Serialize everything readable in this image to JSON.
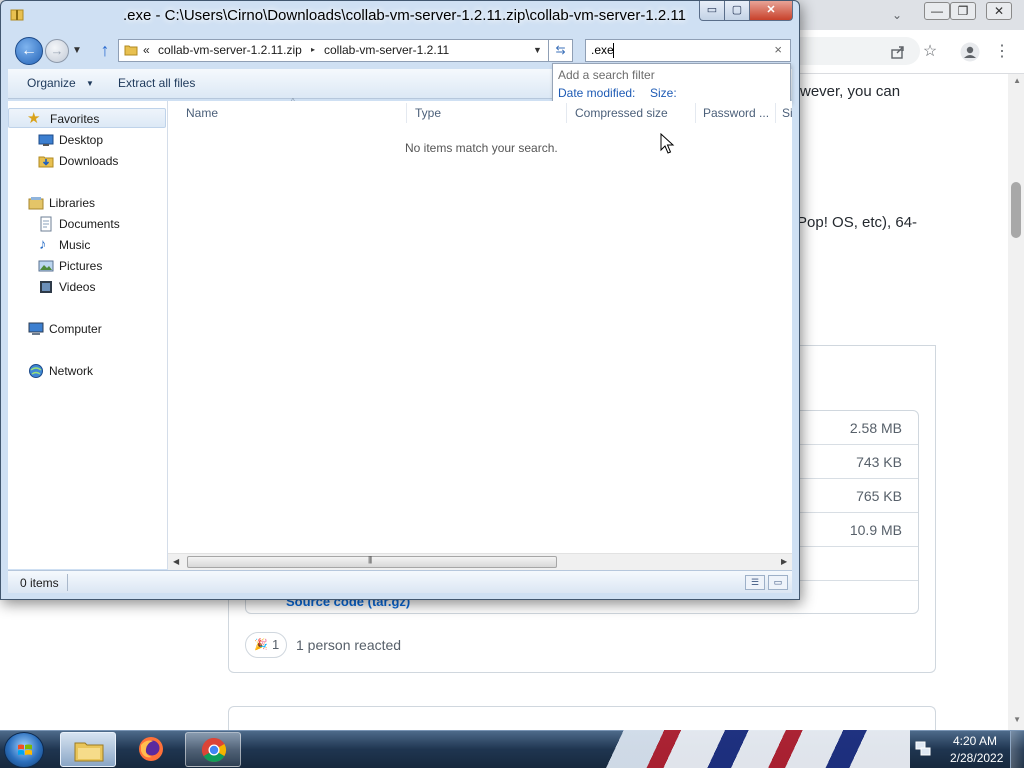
{
  "explorer": {
    "title": ".exe - C:\\Users\\Cirno\\Downloads\\collab-vm-server-1.2.11.zip\\collab-vm-server-1.2.11",
    "caption": {
      "minimize": "▭",
      "maximize": "▢",
      "close": "✕"
    },
    "address": {
      "overflow": "«",
      "crumbs": [
        "collab-vm-server-1.2.11.zip",
        "collab-vm-server-1.2.11"
      ],
      "separator": "▸",
      "dropdown": "▼",
      "refresh": "⇆"
    },
    "search": {
      "value": ".exe",
      "clear": "×",
      "dropdown_hint": "Add a search filter",
      "filters": [
        "Date modified:",
        "Size:"
      ]
    },
    "commands": {
      "organize": "Organize",
      "organize_caret": "▼",
      "extract": "Extract all files"
    },
    "nav": {
      "favorites": "Favorites",
      "desktop": "Desktop",
      "downloads": "Downloads",
      "libraries": "Libraries",
      "documents": "Documents",
      "music": "Music",
      "pictures": "Pictures",
      "videos": "Videos",
      "computer": "Computer",
      "network": "Network"
    },
    "columns": [
      "Name",
      "Type",
      "Compressed size",
      "Password ...",
      "Si"
    ],
    "sort_indicator": "^",
    "empty_message": "No items match your search.",
    "status": "0 items",
    "scroll": {
      "left": "◀",
      "right": "▶",
      "grip": "|||"
    }
  },
  "browser": {
    "window_buttons": [
      "—",
      "❐",
      "✕"
    ],
    "toolbar_icons": [
      "share-icon",
      "star-icon",
      "profile-icon",
      "menu-icon"
    ],
    "text_fragments": [
      "wever, you can",
      "Pop! OS, etc), 64-"
    ],
    "asset_sizes": [
      "2.58 MB",
      "743 KB",
      "765 KB",
      "10.9 MB"
    ],
    "partial_asset": "Source code (tar.gz)",
    "reaction": {
      "emoji": "🎉",
      "count": "1",
      "text": "1 person reacted"
    }
  },
  "taskbar": {
    "apps": [
      "windows-explorer",
      "firefox",
      "chrome"
    ],
    "clock": {
      "time": "4:20 AM",
      "date": "2/28/2022"
    }
  },
  "colors": {
    "aero_frame": "#cfe0f3",
    "link_blue": "#1e5bb5",
    "taskbar": "#1f3550"
  }
}
